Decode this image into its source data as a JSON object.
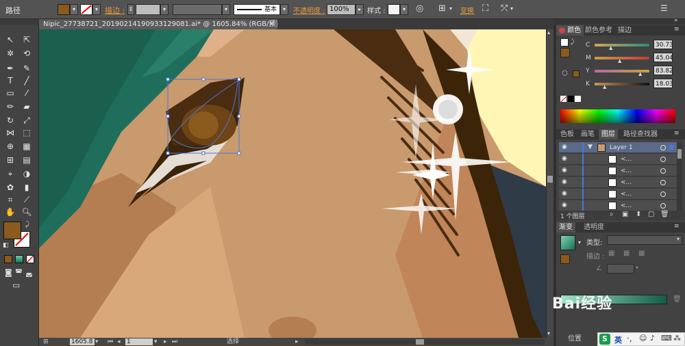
{
  "control_bar": {
    "object_type": "路径",
    "stroke_label": "描边 :",
    "stroke_profile": "基本",
    "opacity_label": "不透明度 :",
    "opacity_value": "100%",
    "style_label": "样式 :",
    "transform_label": "变换",
    "fill_color": "#8b5a1f"
  },
  "document": {
    "tab_title": "Nipic_27738721_20190214190933129081.ai* @ 1605.84% (RGB/预览)",
    "close_glyph": "×"
  },
  "status_bar": {
    "zoom": "1605.8",
    "artboard": "1",
    "tool": "选择"
  },
  "color_panel": {
    "tabs": [
      "颜色",
      "颜色参考",
      "描边"
    ],
    "channels": [
      {
        "label": "C",
        "value": "30.73",
        "level": 0.31
      },
      {
        "label": "M",
        "value": "45.04",
        "level": 0.45
      },
      {
        "label": "Y",
        "value": "83.82",
        "level": 0.84
      },
      {
        "label": "K",
        "value": "18.03",
        "level": 0.18
      }
    ]
  },
  "layers_panel": {
    "tabs": [
      "色板",
      "画笔",
      "图层",
      "路径查找器"
    ],
    "layer_name": "Layer 1",
    "sublayer_label": "<...",
    "count_label": "1 个图层"
  },
  "gradient_panel": {
    "tabs": [
      "渐变",
      "透明度"
    ],
    "type_label": "类型:",
    "stroke_label": "描边 :"
  },
  "watermark": {
    "text": "经验",
    "ime_text": "英"
  },
  "position_label": "位置"
}
